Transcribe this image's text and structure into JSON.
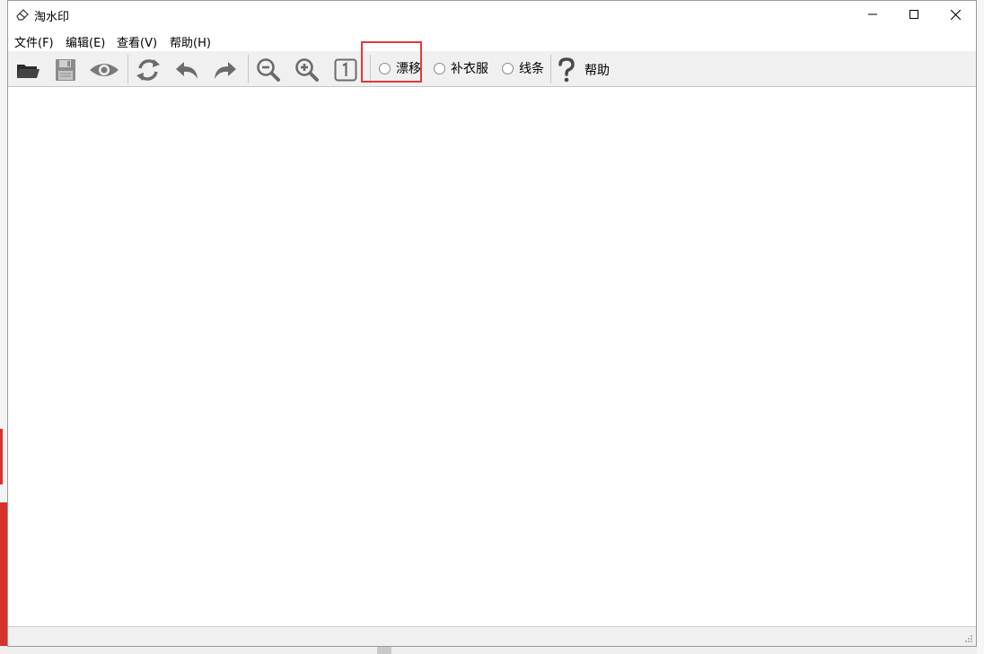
{
  "window": {
    "title": "淘水印"
  },
  "menu": {
    "file": "文件(F)",
    "edit": "编辑(E)",
    "view": "查看(V)",
    "help": "帮助(H)"
  },
  "toolbar": {
    "icons": [
      "open-folder-icon",
      "save-icon",
      "preview-eye-icon",
      "refresh-icon",
      "undo-icon",
      "redo-icon",
      "zoom-out-icon",
      "zoom-in-icon",
      "actual-size-icon"
    ],
    "modes": [
      {
        "label": "漂移",
        "selected": false
      },
      {
        "label": "补衣服",
        "selected": false
      },
      {
        "label": "线条",
        "selected": false
      }
    ],
    "help_label": "帮助"
  },
  "colors": {
    "toolbar_bg": "#f0f0f0",
    "icon_gray": "#6b6b6b",
    "highlight_red": "#e23a3a"
  }
}
